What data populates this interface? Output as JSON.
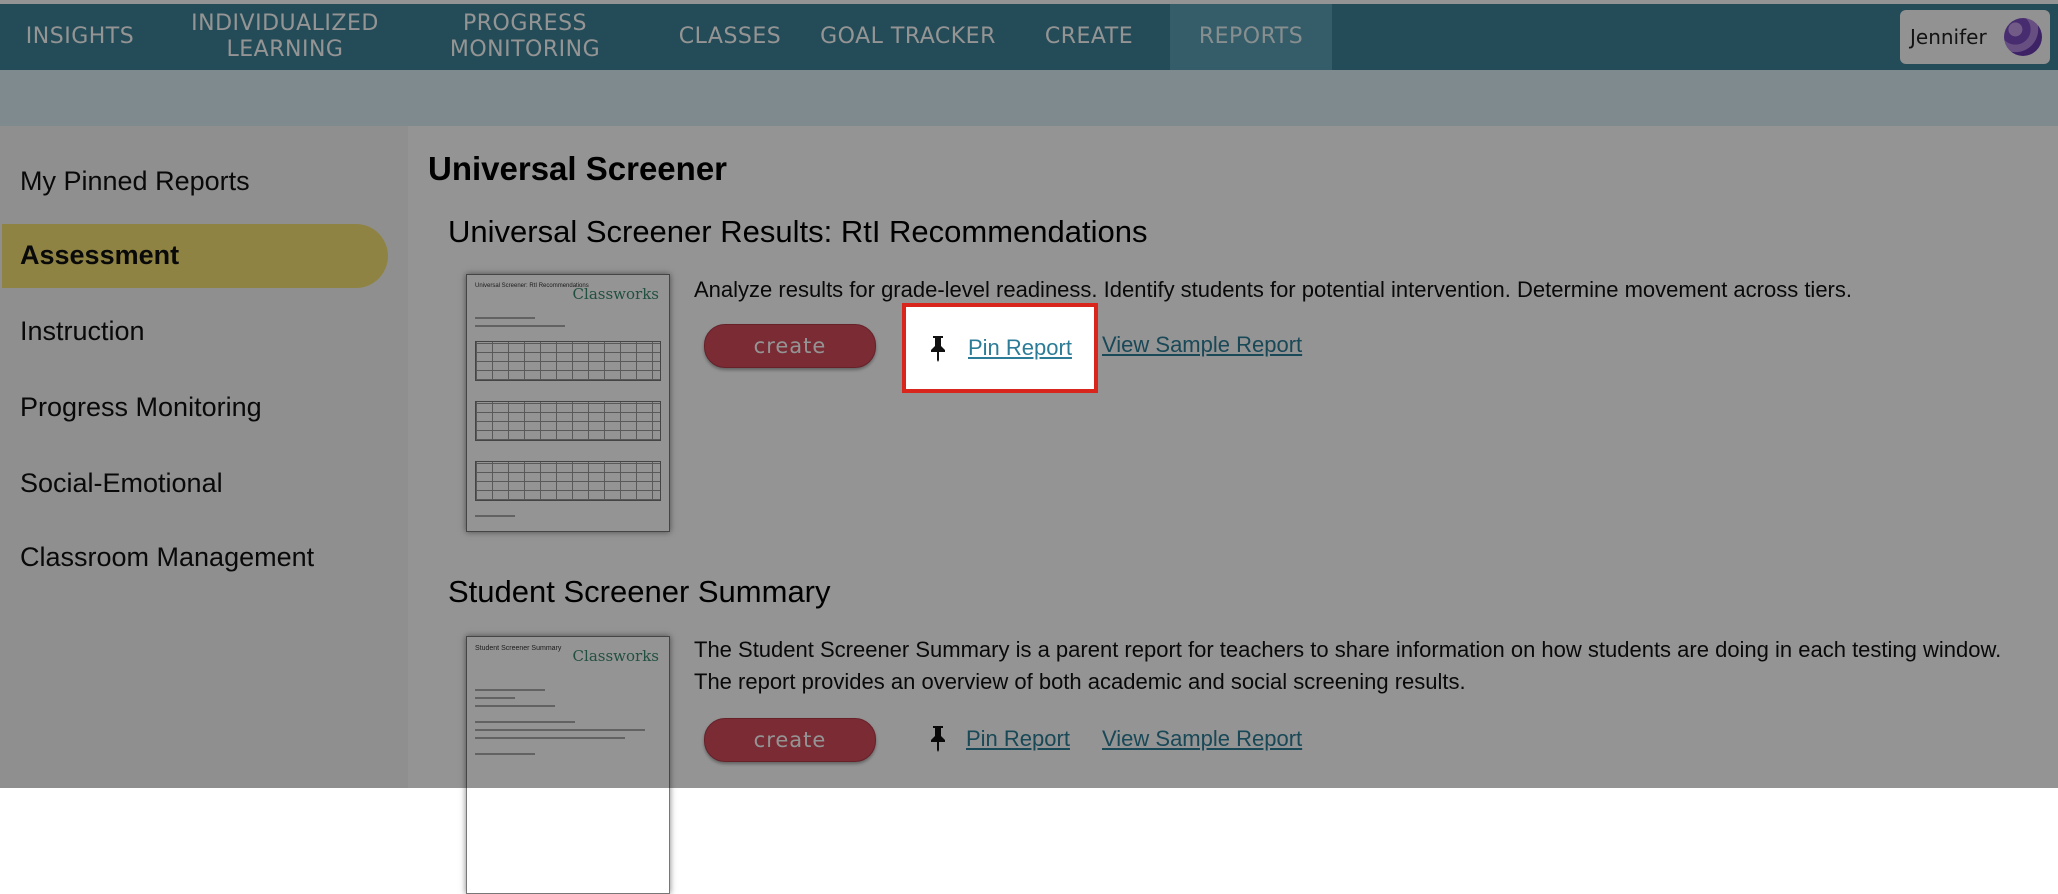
{
  "nav": {
    "items": [
      "INSIGHTS",
      "INDIVIDUALIZED LEARNING",
      "PROGRESS MONITORING",
      "CLASSES",
      "GOAL TRACKER",
      "CREATE",
      "REPORTS"
    ],
    "active": "REPORTS",
    "user_name": "Jennifer"
  },
  "sidebar": {
    "items": [
      "My Pinned Reports",
      "Assessment",
      "Instruction",
      "Progress Monitoring",
      "Social-Emotional",
      "Classroom Management"
    ],
    "active": "Assessment"
  },
  "main": {
    "page_title": "Universal Screener",
    "reports": [
      {
        "title": "Universal Screener Results: RtI Recommendations",
        "description": "Analyze results for grade-level readiness. Identify students for potential intervention. Determine movement across tiers.",
        "create_label": "create",
        "pin_label": "Pin Report",
        "sample_label": "View Sample Report",
        "thumb_title": "Universal Screener: RtI Recommendations",
        "thumb_logo": "Classworks"
      },
      {
        "title": "Student Screener Summary",
        "description": "The Student Screener Summary is a parent report for teachers to share information on how students are doing in each testing window. The report provides an overview of both academic and social screening results.",
        "create_label": "create",
        "pin_label": "Pin Report",
        "sample_label": "View Sample Report",
        "thumb_title": "Student Screener Summary",
        "thumb_logo": "Classworks"
      }
    ]
  },
  "colors": {
    "nav_bg": "#3f8498",
    "active_sidebar": "#f6e276",
    "create_button": "#d24b5a",
    "link": "#2c7c97",
    "highlight_border": "#d9261c"
  }
}
